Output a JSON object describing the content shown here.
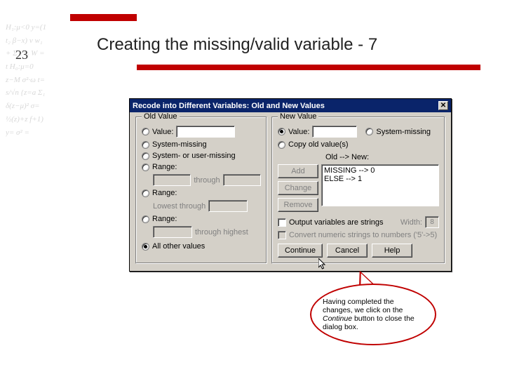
{
  "slide": {
    "number": "23",
    "title": "Creating the missing/valid variable - 7"
  },
  "dialog": {
    "title": "Recode into Different Variables: Old and New Values",
    "close_glyph": "✕",
    "old": {
      "legend": "Old Value",
      "value_label": "Value:",
      "sysmis": "System-missing",
      "sys_user": "System- or user-missing",
      "range1": "Range:",
      "through": "through",
      "range2": "Range:",
      "lowest_through": "Lowest through",
      "range3": "Range:",
      "through_highest": "through highest",
      "all_other": "All other values"
    },
    "new": {
      "legend": "New Value",
      "value_label": "Value:",
      "sysmis": "System-missing",
      "copy": "Copy old value(s)",
      "old_new": "Old --> New:",
      "add": "Add",
      "change": "Change",
      "remove": "Remove",
      "rules": [
        "MISSING --> 0",
        "ELSE --> 1"
      ],
      "out_strings": "Output variables are strings",
      "width_label": "Width:",
      "width_value": "8",
      "convert": "Convert numeric strings to numbers ('5'->5)"
    },
    "buttons": {
      "continue": "Continue",
      "cancel": "Cancel",
      "help": "Help"
    }
  },
  "callout": {
    "line1": "Having completed the changes, we click on the ",
    "emph": "Continue",
    "line2": " button to close the dialog box."
  },
  "math_bg": "H₁:μ<0\ny=(1\nt₂\nβ−x)\nv\nw₁\n+\nΣ\nε t₁\nW =\nt\nH₀:μ=0\nz−M\nσ²·ω\nt=\ns/√n\n{z=a\nΣ₁\nδ(z−μ)²\nσ=\n½(z)+z f+1)\ny=\nσ² ="
}
